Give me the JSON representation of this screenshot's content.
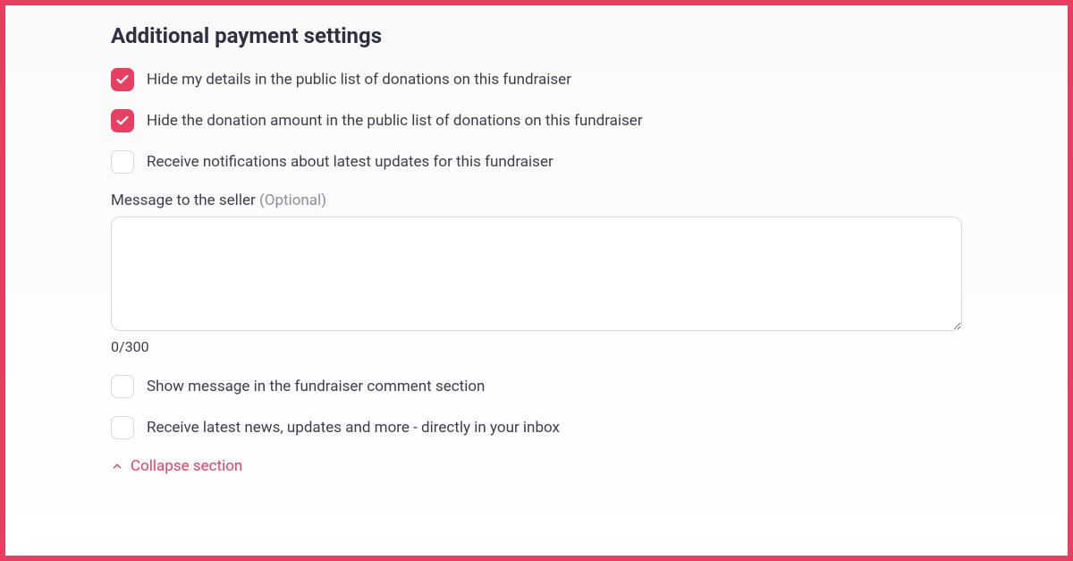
{
  "section": {
    "title": "Additional payment settings"
  },
  "checkboxes": {
    "hideDetails": {
      "label": "Hide my details in the public list of donations on this fundraiser",
      "checked": true
    },
    "hideAmount": {
      "label": "Hide the donation amount in the public list of donations on this fundraiser",
      "checked": true
    },
    "notifications": {
      "label": "Receive notifications about latest updates for this fundraiser",
      "checked": false
    },
    "showMessage": {
      "label": "Show message in the fundraiser comment section",
      "checked": false
    },
    "receiveNews": {
      "label": "Receive latest news, updates and more - directly in your inbox",
      "checked": false
    }
  },
  "messageField": {
    "label": "Message to the seller ",
    "optional": "(Optional)",
    "value": "",
    "charCount": "0/300"
  },
  "collapse": {
    "label": "Collapse section"
  }
}
